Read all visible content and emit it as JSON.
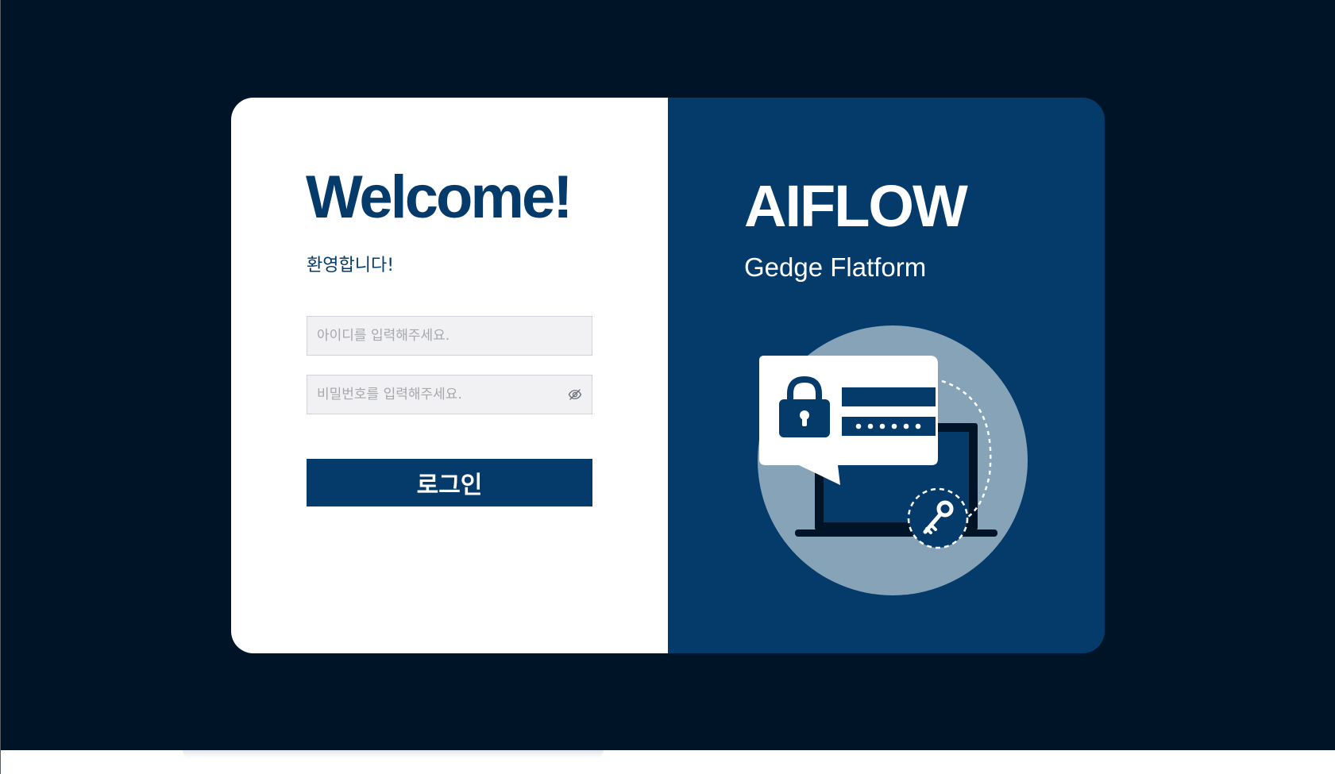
{
  "login": {
    "title": "Welcome!",
    "subtitle": "환영합니다!",
    "id_placeholder": "아이디를 입력해주세요.",
    "password_placeholder": "비밀번호를 입력해주세요.",
    "login_button": "로그인",
    "password_toggle_icon": "eye-slash-icon"
  },
  "brand": {
    "name": "AIFLOW",
    "tagline": "Gedge Flatform",
    "illustration_icons": [
      "padlock-icon",
      "password-field-icon",
      "laptop-icon",
      "key-icon"
    ]
  },
  "colors": {
    "primary": "#043b6a",
    "background": "#001427",
    "illustration_circle": "#86a3b8",
    "input_background": "#f1f1f4"
  }
}
